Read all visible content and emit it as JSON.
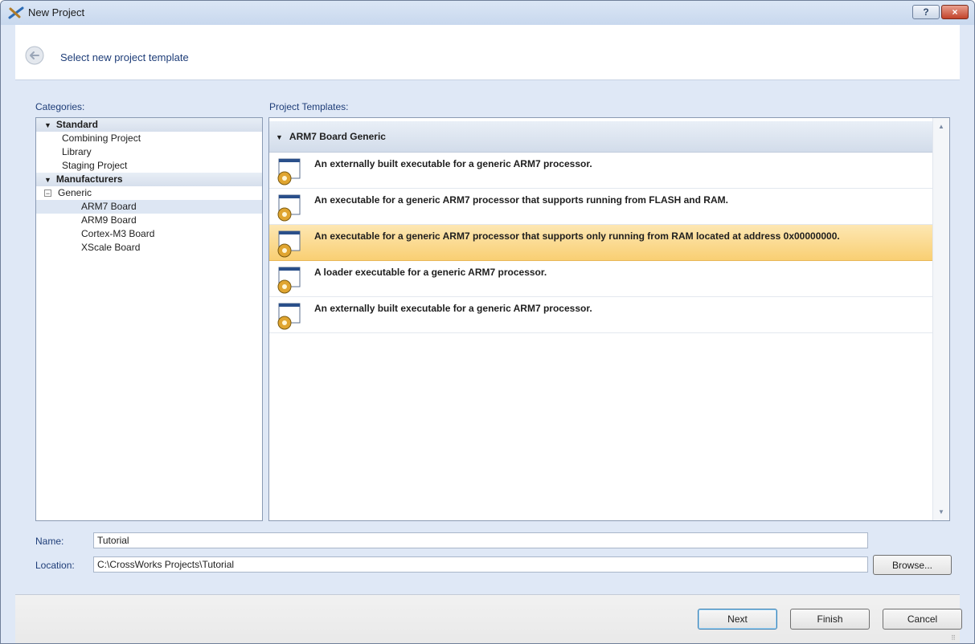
{
  "window": {
    "title": "New Project",
    "help_label": "?",
    "close_label": "×"
  },
  "header": {
    "title": "Select new project template"
  },
  "categories": {
    "label": "Categories:",
    "groups": [
      {
        "name": "Standard",
        "items": [
          "Combining Project",
          "Library",
          "Staging Project"
        ]
      },
      {
        "name": "Manufacturers",
        "tree": {
          "name": "Generic",
          "expander": "−",
          "items": [
            "ARM7 Board",
            "ARM9 Board",
            "Cortex-M3 Board",
            "XScale Board"
          ]
        }
      }
    ],
    "selected": "ARM7 Board"
  },
  "templates": {
    "label": "Project Templates:",
    "group": "ARM7 Board Generic",
    "items": [
      "An externally built executable for a generic ARM7 processor.",
      "An executable for a generic ARM7 processor that supports running from FLASH and RAM.",
      "An executable for a generic ARM7 processor that supports only running from RAM located at address 0x00000000.",
      "A loader executable for a generic ARM7 processor.",
      "An externally built executable for a generic ARM7 processor."
    ],
    "selected_index": 2
  },
  "form": {
    "name_label": "Name:",
    "name_value": "Tutorial",
    "location_label": "Location:",
    "location_value": "C:\\CrossWorks Projects\\Tutorial",
    "browse_label": "Browse..."
  },
  "buttons": {
    "next": "Next",
    "finish": "Finish",
    "cancel": "Cancel"
  },
  "colors": {
    "selection_gold": "#f9cf73",
    "header_link": "#1e3d78",
    "dialog_bg": "#dfe8f6"
  }
}
